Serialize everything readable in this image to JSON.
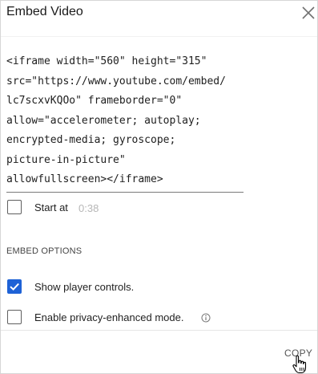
{
  "dialog": {
    "title": "Embed Video"
  },
  "embed": {
    "code_lines": [
      "<iframe width=\"560\" height=\"315\"",
      "src=\"https://www.youtube.com/embed/",
      "lc7scxvKQOo\" frameborder=\"0\"",
      "allow=\"accelerometer; autoplay;",
      "encrypted-media; gyroscope;",
      "picture-in-picture\"",
      "allowfullscreen></iframe>"
    ]
  },
  "start_at": {
    "label": "Start at",
    "time": "0:38",
    "checked": false
  },
  "options": {
    "heading": "EMBED OPTIONS",
    "show_controls": {
      "label": "Show player controls.",
      "checked": true
    },
    "privacy_mode": {
      "label": "Enable privacy-enhanced mode.",
      "checked": false
    }
  },
  "actions": {
    "copy_label": "COPY"
  },
  "colors": {
    "accent": "#1e62d6"
  },
  "icons": {
    "close": "close-icon",
    "info": "info-icon",
    "check": "checkmark-icon",
    "cursor": "hand-pointer-cursor"
  }
}
